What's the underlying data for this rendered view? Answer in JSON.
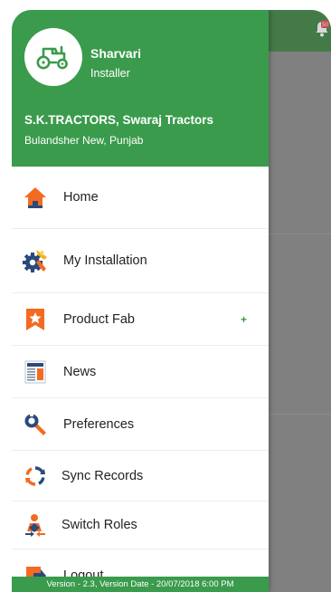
{
  "background": {
    "notification_badge": "50"
  },
  "profile": {
    "name": "Sharvari",
    "role": "Installer",
    "avatar_icon": "tractor-icon"
  },
  "dealer": {
    "name": "S.K.TRACTORS, Swaraj Tractors",
    "location": "Bulandsher New, Punjab"
  },
  "menu": {
    "items": [
      {
        "label": "Home",
        "icon": "home-icon"
      },
      {
        "label": "My Installation",
        "icon": "installation-gear-icon"
      },
      {
        "label": "Product Fab",
        "icon": "star-bookmark-icon",
        "expand": "+"
      },
      {
        "label": "News",
        "icon": "newspaper-icon"
      },
      {
        "label": "Preferences",
        "icon": "wrench-icon"
      },
      {
        "label": "Sync Records",
        "icon": "sync-icon"
      },
      {
        "label": "Switch Roles",
        "icon": "switch-user-icon"
      },
      {
        "label": "Logout",
        "icon": "logout-icon"
      }
    ]
  },
  "footer": {
    "version_text": "Version - 2.3, Version Date - 20/07/2018 6:00 PM"
  },
  "colors": {
    "primary_green": "#3a9b4c",
    "icon_orange": "#f26b21",
    "icon_blue": "#2a4a7b",
    "overlay_gray": "#808080"
  }
}
